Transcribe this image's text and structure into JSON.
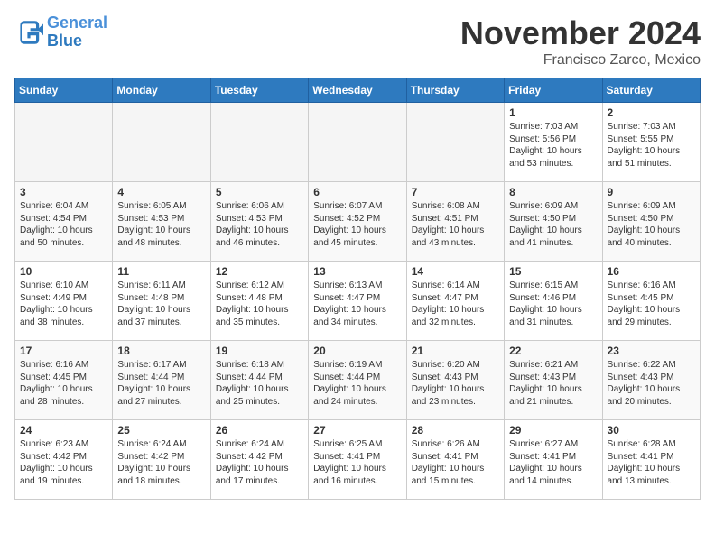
{
  "logo": {
    "line1": "General",
    "line2": "Blue"
  },
  "title": "November 2024",
  "location": "Francisco Zarco, Mexico",
  "days_of_week": [
    "Sunday",
    "Monday",
    "Tuesday",
    "Wednesday",
    "Thursday",
    "Friday",
    "Saturday"
  ],
  "weeks": [
    [
      {
        "day": "",
        "info": ""
      },
      {
        "day": "",
        "info": ""
      },
      {
        "day": "",
        "info": ""
      },
      {
        "day": "",
        "info": ""
      },
      {
        "day": "",
        "info": ""
      },
      {
        "day": "1",
        "info": "Sunrise: 7:03 AM\nSunset: 5:56 PM\nDaylight: 10 hours\nand 53 minutes."
      },
      {
        "day": "2",
        "info": "Sunrise: 7:03 AM\nSunset: 5:55 PM\nDaylight: 10 hours\nand 51 minutes."
      }
    ],
    [
      {
        "day": "3",
        "info": "Sunrise: 6:04 AM\nSunset: 4:54 PM\nDaylight: 10 hours\nand 50 minutes."
      },
      {
        "day": "4",
        "info": "Sunrise: 6:05 AM\nSunset: 4:53 PM\nDaylight: 10 hours\nand 48 minutes."
      },
      {
        "day": "5",
        "info": "Sunrise: 6:06 AM\nSunset: 4:53 PM\nDaylight: 10 hours\nand 46 minutes."
      },
      {
        "day": "6",
        "info": "Sunrise: 6:07 AM\nSunset: 4:52 PM\nDaylight: 10 hours\nand 45 minutes."
      },
      {
        "day": "7",
        "info": "Sunrise: 6:08 AM\nSunset: 4:51 PM\nDaylight: 10 hours\nand 43 minutes."
      },
      {
        "day": "8",
        "info": "Sunrise: 6:09 AM\nSunset: 4:50 PM\nDaylight: 10 hours\nand 41 minutes."
      },
      {
        "day": "9",
        "info": "Sunrise: 6:09 AM\nSunset: 4:50 PM\nDaylight: 10 hours\nand 40 minutes."
      }
    ],
    [
      {
        "day": "10",
        "info": "Sunrise: 6:10 AM\nSunset: 4:49 PM\nDaylight: 10 hours\nand 38 minutes."
      },
      {
        "day": "11",
        "info": "Sunrise: 6:11 AM\nSunset: 4:48 PM\nDaylight: 10 hours\nand 37 minutes."
      },
      {
        "day": "12",
        "info": "Sunrise: 6:12 AM\nSunset: 4:48 PM\nDaylight: 10 hours\nand 35 minutes."
      },
      {
        "day": "13",
        "info": "Sunrise: 6:13 AM\nSunset: 4:47 PM\nDaylight: 10 hours\nand 34 minutes."
      },
      {
        "day": "14",
        "info": "Sunrise: 6:14 AM\nSunset: 4:47 PM\nDaylight: 10 hours\nand 32 minutes."
      },
      {
        "day": "15",
        "info": "Sunrise: 6:15 AM\nSunset: 4:46 PM\nDaylight: 10 hours\nand 31 minutes."
      },
      {
        "day": "16",
        "info": "Sunrise: 6:16 AM\nSunset: 4:45 PM\nDaylight: 10 hours\nand 29 minutes."
      }
    ],
    [
      {
        "day": "17",
        "info": "Sunrise: 6:16 AM\nSunset: 4:45 PM\nDaylight: 10 hours\nand 28 minutes."
      },
      {
        "day": "18",
        "info": "Sunrise: 6:17 AM\nSunset: 4:44 PM\nDaylight: 10 hours\nand 27 minutes."
      },
      {
        "day": "19",
        "info": "Sunrise: 6:18 AM\nSunset: 4:44 PM\nDaylight: 10 hours\nand 25 minutes."
      },
      {
        "day": "20",
        "info": "Sunrise: 6:19 AM\nSunset: 4:44 PM\nDaylight: 10 hours\nand 24 minutes."
      },
      {
        "day": "21",
        "info": "Sunrise: 6:20 AM\nSunset: 4:43 PM\nDaylight: 10 hours\nand 23 minutes."
      },
      {
        "day": "22",
        "info": "Sunrise: 6:21 AM\nSunset: 4:43 PM\nDaylight: 10 hours\nand 21 minutes."
      },
      {
        "day": "23",
        "info": "Sunrise: 6:22 AM\nSunset: 4:43 PM\nDaylight: 10 hours\nand 20 minutes."
      }
    ],
    [
      {
        "day": "24",
        "info": "Sunrise: 6:23 AM\nSunset: 4:42 PM\nDaylight: 10 hours\nand 19 minutes."
      },
      {
        "day": "25",
        "info": "Sunrise: 6:24 AM\nSunset: 4:42 PM\nDaylight: 10 hours\nand 18 minutes."
      },
      {
        "day": "26",
        "info": "Sunrise: 6:24 AM\nSunset: 4:42 PM\nDaylight: 10 hours\nand 17 minutes."
      },
      {
        "day": "27",
        "info": "Sunrise: 6:25 AM\nSunset: 4:41 PM\nDaylight: 10 hours\nand 16 minutes."
      },
      {
        "day": "28",
        "info": "Sunrise: 6:26 AM\nSunset: 4:41 PM\nDaylight: 10 hours\nand 15 minutes."
      },
      {
        "day": "29",
        "info": "Sunrise: 6:27 AM\nSunset: 4:41 PM\nDaylight: 10 hours\nand 14 minutes."
      },
      {
        "day": "30",
        "info": "Sunrise: 6:28 AM\nSunset: 4:41 PM\nDaylight: 10 hours\nand 13 minutes."
      }
    ]
  ]
}
